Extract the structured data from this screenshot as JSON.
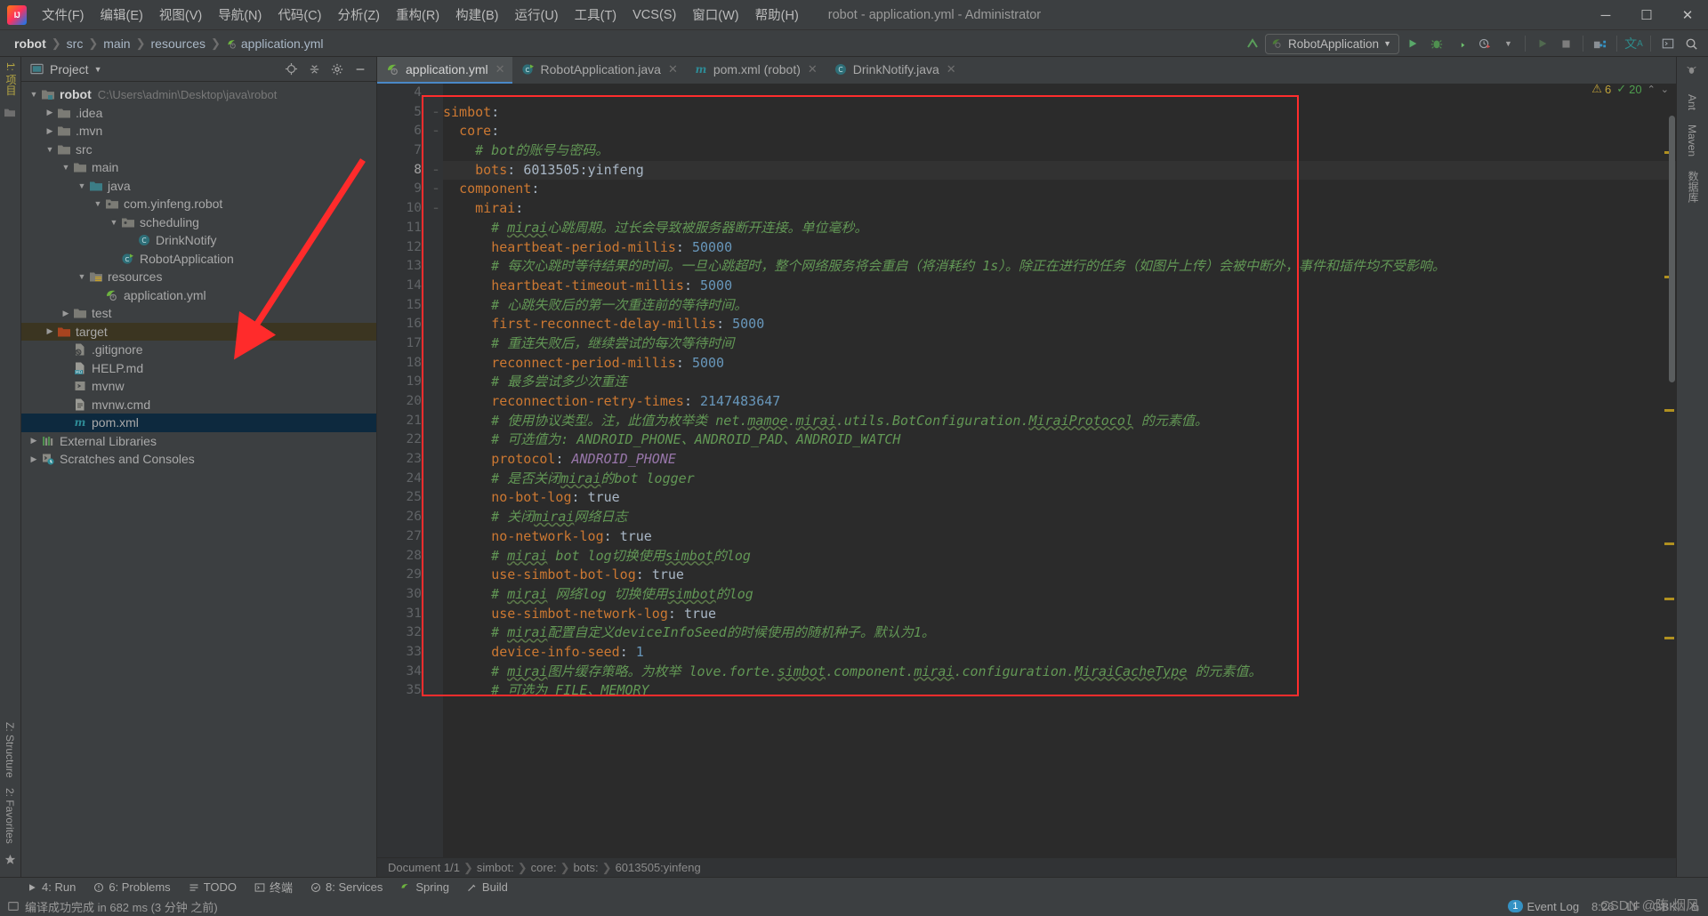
{
  "window": {
    "title": "robot - application.yml - Administrator",
    "controls": [
      "minimize",
      "maximize",
      "close"
    ]
  },
  "menubar": {
    "items": [
      "文件(F)",
      "编辑(E)",
      "视图(V)",
      "导航(N)",
      "代码(C)",
      "分析(Z)",
      "重构(R)",
      "构建(B)",
      "运行(U)",
      "工具(T)",
      "VCS(S)",
      "窗口(W)",
      "帮助(H)"
    ]
  },
  "breadcrumb": {
    "items": [
      "robot",
      "src",
      "main",
      "resources",
      "application.yml"
    ]
  },
  "run_config": {
    "name": "RobotApplication",
    "dropdown_glyph": "▼"
  },
  "toolbar_right": {
    "buttons": [
      "update-project-icon",
      "run-icon",
      "debug-icon",
      "run-coverage-icon",
      "profiler-icon",
      "profiler-dropdown-icon",
      "run-step-icon",
      "stop-icon",
      "build-project-icon",
      "translate-icon",
      "terminal-icon",
      "search-everywhere-icon"
    ]
  },
  "left_strip": {
    "top_tab": "1: 项目",
    "bottom_tabs": [
      "Z: Structure",
      "2: Favorites"
    ]
  },
  "right_strip": {
    "tabs": [
      "Maven",
      "数据库",
      "Ant"
    ]
  },
  "project_panel": {
    "title": "Project",
    "title_chevron": "▼",
    "header_buttons": [
      "locate-icon",
      "collapse-all-icon",
      "settings-icon",
      "hide-icon"
    ],
    "tree": [
      {
        "depth": 0,
        "twisty": "open",
        "icon": "module-folder",
        "label": "robot",
        "bold": true,
        "path": "C:\\Users\\admin\\Desktop\\java\\robot",
        "selected": "none"
      },
      {
        "depth": 1,
        "twisty": "closed",
        "icon": "folder",
        "label": ".idea",
        "selected": "none"
      },
      {
        "depth": 1,
        "twisty": "closed",
        "icon": "folder",
        "label": ".mvn",
        "selected": "none"
      },
      {
        "depth": 1,
        "twisty": "open",
        "icon": "folder",
        "label": "src",
        "selected": "none"
      },
      {
        "depth": 2,
        "twisty": "open",
        "icon": "folder",
        "label": "main",
        "selected": "none"
      },
      {
        "depth": 3,
        "twisty": "open",
        "icon": "source-folder",
        "label": "java",
        "selected": "none"
      },
      {
        "depth": 4,
        "twisty": "open",
        "icon": "package",
        "label": "com.yinfeng.robot",
        "selected": "none"
      },
      {
        "depth": 5,
        "twisty": "open",
        "icon": "package",
        "label": "scheduling",
        "selected": "none"
      },
      {
        "depth": 6,
        "twisty": "none",
        "icon": "java-class",
        "label": "DrinkNotify",
        "selected": "none"
      },
      {
        "depth": 5,
        "twisty": "none",
        "icon": "spring-class",
        "label": "RobotApplication",
        "selected": "none"
      },
      {
        "depth": 3,
        "twisty": "open",
        "icon": "resource-folder",
        "label": "resources",
        "selected": "none"
      },
      {
        "depth": 4,
        "twisty": "none",
        "icon": "spring-yaml",
        "label": "application.yml",
        "selected": "none"
      },
      {
        "depth": 2,
        "twisty": "closed",
        "icon": "folder",
        "label": "test",
        "selected": "none"
      },
      {
        "depth": 1,
        "twisty": "closed",
        "icon": "excluded-folder",
        "label": "target",
        "selected": "orange"
      },
      {
        "depth": 2,
        "twisty": "none",
        "icon": "gitignore",
        "label": ".gitignore",
        "selected": "none"
      },
      {
        "depth": 2,
        "twisty": "none",
        "icon": "markdown",
        "label": "HELP.md",
        "selected": "none"
      },
      {
        "depth": 2,
        "twisty": "none",
        "icon": "shell-script",
        "label": "mvnw",
        "selected": "none"
      },
      {
        "depth": 2,
        "twisty": "none",
        "icon": "cmd-file",
        "label": "mvnw.cmd",
        "selected": "none"
      },
      {
        "depth": 2,
        "twisty": "none",
        "icon": "maven-pom",
        "label": "pom.xml",
        "selected": "blur"
      },
      {
        "depth": 0,
        "twisty": "closed",
        "icon": "libraries",
        "label": "External Libraries",
        "selected": "none"
      },
      {
        "depth": 0,
        "twisty": "closed",
        "icon": "scratches",
        "label": "Scratches and Consoles",
        "selected": "none"
      }
    ]
  },
  "editor_tabs": [
    {
      "label": "application.yml",
      "icon": "spring-yaml",
      "active": true
    },
    {
      "label": "RobotApplication.java",
      "icon": "spring-class",
      "active": false
    },
    {
      "label": "pom.xml (robot)",
      "icon": "maven-pom",
      "active": false
    },
    {
      "label": "DrinkNotify.java",
      "icon": "java-class",
      "active": false
    }
  ],
  "editor_status_right": {
    "warnings": "6",
    "checks": "20",
    "warn_glyph": "⚠",
    "ok_glyph": "✓",
    "up_glyph": "⌃",
    "down_glyph": "⌄"
  },
  "code": {
    "first_line": 4,
    "current_line": 8,
    "lines": [
      {
        "n": 4,
        "fold": "",
        "tokens": []
      },
      {
        "n": 5,
        "fold": "−",
        "tokens": [
          {
            "t": "simbot",
            "c": "k"
          },
          {
            "t": ":",
            "c": "p"
          }
        ]
      },
      {
        "n": 6,
        "fold": "−",
        "tokens": [
          {
            "t": "  ",
            "c": "p"
          },
          {
            "t": "core",
            "c": "k"
          },
          {
            "t": ":",
            "c": "p"
          }
        ]
      },
      {
        "n": 7,
        "fold": "",
        "tokens": [
          {
            "t": "    # bot的账号与密码。",
            "c": "c"
          }
        ]
      },
      {
        "n": 8,
        "fold": "−",
        "tokens": [
          {
            "t": "    ",
            "c": "p"
          },
          {
            "t": "bots",
            "c": "k"
          },
          {
            "t": ": ",
            "c": "p"
          },
          {
            "t": "6013505:yinfeng",
            "c": "s"
          }
        ],
        "highlight": true
      },
      {
        "n": 9,
        "fold": "−",
        "tokens": [
          {
            "t": "  ",
            "c": "p"
          },
          {
            "t": "component",
            "c": "k"
          },
          {
            "t": ":",
            "c": "p"
          }
        ]
      },
      {
        "n": 10,
        "fold": "−",
        "tokens": [
          {
            "t": "    ",
            "c": "p"
          },
          {
            "t": "mirai",
            "c": "k"
          },
          {
            "t": ":",
            "c": "p"
          }
        ]
      },
      {
        "n": 11,
        "fold": "",
        "tokens": [
          {
            "t": "      # ",
            "c": "c"
          },
          {
            "t": "mirai",
            "c": "c sq"
          },
          {
            "t": "心跳周期。过长会导致被服务器断开连接。单位毫秒。",
            "c": "c"
          }
        ]
      },
      {
        "n": 12,
        "fold": "",
        "tokens": [
          {
            "t": "      ",
            "c": "p"
          },
          {
            "t": "heartbeat-period-millis",
            "c": "k"
          },
          {
            "t": ": ",
            "c": "p"
          },
          {
            "t": "50000",
            "c": "n"
          }
        ]
      },
      {
        "n": 13,
        "fold": "",
        "tokens": [
          {
            "t": "      # 每次心跳时等待结果的时间。一旦心跳超时，整个网络服务将会重启（将消耗约 1s）。除正在进行的任务（如图片上传）会被中断外，事件和插件均不受影响。",
            "c": "c"
          }
        ]
      },
      {
        "n": 14,
        "fold": "",
        "tokens": [
          {
            "t": "      ",
            "c": "p"
          },
          {
            "t": "heartbeat-timeout-millis",
            "c": "k"
          },
          {
            "t": ": ",
            "c": "p"
          },
          {
            "t": "5000",
            "c": "n"
          }
        ]
      },
      {
        "n": 15,
        "fold": "",
        "tokens": [
          {
            "t": "      # 心跳失败后的第一次重连前的等待时间。",
            "c": "c"
          }
        ]
      },
      {
        "n": 16,
        "fold": "",
        "tokens": [
          {
            "t": "      ",
            "c": "p"
          },
          {
            "t": "first-reconnect-delay-millis",
            "c": "k"
          },
          {
            "t": ": ",
            "c": "p"
          },
          {
            "t": "5000",
            "c": "n"
          }
        ]
      },
      {
        "n": 17,
        "fold": "",
        "tokens": [
          {
            "t": "      # 重连失败后，继续尝试的每次等待时间",
            "c": "c"
          }
        ]
      },
      {
        "n": 18,
        "fold": "",
        "tokens": [
          {
            "t": "      ",
            "c": "p"
          },
          {
            "t": "reconnect-period-millis",
            "c": "k"
          },
          {
            "t": ": ",
            "c": "p"
          },
          {
            "t": "5000",
            "c": "n"
          }
        ]
      },
      {
        "n": 19,
        "fold": "",
        "tokens": [
          {
            "t": "      # 最多尝试多少次重连",
            "c": "c"
          }
        ]
      },
      {
        "n": 20,
        "fold": "",
        "tokens": [
          {
            "t": "      ",
            "c": "p"
          },
          {
            "t": "reconnection-retry-times",
            "c": "k"
          },
          {
            "t": ": ",
            "c": "p"
          },
          {
            "t": "2147483647",
            "c": "n"
          }
        ]
      },
      {
        "n": 21,
        "fold": "",
        "tokens": [
          {
            "t": "      # 使用协议类型。注，此值为枚举类 net.",
            "c": "c"
          },
          {
            "t": "mamoe",
            "c": "c sq"
          },
          {
            "t": ".",
            "c": "c"
          },
          {
            "t": "mirai",
            "c": "c sq"
          },
          {
            "t": ".utils.BotConfiguration.",
            "c": "c"
          },
          {
            "t": "MiraiProtocol",
            "c": "c sq"
          },
          {
            "t": " 的元素值。",
            "c": "c"
          }
        ]
      },
      {
        "n": 22,
        "fold": "",
        "tokens": [
          {
            "t": "      # 可选值为: ANDROID_PHONE、ANDROID_PAD、ANDROID_WATCH",
            "c": "c"
          }
        ]
      },
      {
        "n": 23,
        "fold": "",
        "tokens": [
          {
            "t": "      ",
            "c": "p"
          },
          {
            "t": "protocol",
            "c": "k"
          },
          {
            "t": ": ",
            "c": "p"
          },
          {
            "t": "ANDROID_PHONE",
            "c": "e"
          }
        ]
      },
      {
        "n": 24,
        "fold": "",
        "tokens": [
          {
            "t": "      # 是否关闭",
            "c": "c"
          },
          {
            "t": "mirai",
            "c": "c sq"
          },
          {
            "t": "的bot logger",
            "c": "c"
          }
        ]
      },
      {
        "n": 25,
        "fold": "",
        "tokens": [
          {
            "t": "      ",
            "c": "p"
          },
          {
            "t": "no-bot-log",
            "c": "k"
          },
          {
            "t": ": ",
            "c": "p"
          },
          {
            "t": "true",
            "c": "s"
          }
        ]
      },
      {
        "n": 26,
        "fold": "",
        "tokens": [
          {
            "t": "      # 关闭",
            "c": "c"
          },
          {
            "t": "mirai",
            "c": "c sq"
          },
          {
            "t": "网络日志",
            "c": "c"
          }
        ]
      },
      {
        "n": 27,
        "fold": "",
        "tokens": [
          {
            "t": "      ",
            "c": "p"
          },
          {
            "t": "no-network-log",
            "c": "k"
          },
          {
            "t": ": ",
            "c": "p"
          },
          {
            "t": "true",
            "c": "s"
          }
        ]
      },
      {
        "n": 28,
        "fold": "",
        "tokens": [
          {
            "t": "      # ",
            "c": "c"
          },
          {
            "t": "mirai",
            "c": "c sq"
          },
          {
            "t": " bot log切换使用",
            "c": "c"
          },
          {
            "t": "simbot",
            "c": "c sq"
          },
          {
            "t": "的log",
            "c": "c"
          }
        ]
      },
      {
        "n": 29,
        "fold": "",
        "tokens": [
          {
            "t": "      ",
            "c": "p"
          },
          {
            "t": "use-simbot-bot-log",
            "c": "k"
          },
          {
            "t": ": ",
            "c": "p"
          },
          {
            "t": "true",
            "c": "s"
          }
        ]
      },
      {
        "n": 30,
        "fold": "",
        "tokens": [
          {
            "t": "      # ",
            "c": "c"
          },
          {
            "t": "mirai",
            "c": "c sq"
          },
          {
            "t": " 网络log 切换使用",
            "c": "c"
          },
          {
            "t": "simbot",
            "c": "c sq"
          },
          {
            "t": "的log",
            "c": "c"
          }
        ]
      },
      {
        "n": 31,
        "fold": "",
        "tokens": [
          {
            "t": "      ",
            "c": "p"
          },
          {
            "t": "use-simbot-network-log",
            "c": "k"
          },
          {
            "t": ": ",
            "c": "p"
          },
          {
            "t": "true",
            "c": "s"
          }
        ]
      },
      {
        "n": 32,
        "fold": "",
        "tokens": [
          {
            "t": "      # ",
            "c": "c"
          },
          {
            "t": "mirai",
            "c": "c sq"
          },
          {
            "t": "配置自定义deviceInfoSeed的时候使用的随机种子。默认为1。",
            "c": "c"
          }
        ]
      },
      {
        "n": 33,
        "fold": "",
        "tokens": [
          {
            "t": "      ",
            "c": "p"
          },
          {
            "t": "device-info-seed",
            "c": "k"
          },
          {
            "t": ": ",
            "c": "p"
          },
          {
            "t": "1",
            "c": "n"
          }
        ]
      },
      {
        "n": 34,
        "fold": "",
        "tokens": [
          {
            "t": "      # ",
            "c": "c"
          },
          {
            "t": "mirai",
            "c": "c sq"
          },
          {
            "t": "图片缓存策略。为枚举 love.forte.",
            "c": "c"
          },
          {
            "t": "simbot",
            "c": "c sq"
          },
          {
            "t": ".component.",
            "c": "c"
          },
          {
            "t": "mirai",
            "c": "c sq"
          },
          {
            "t": ".configuration.",
            "c": "c"
          },
          {
            "t": "MiraiCacheType",
            "c": "c sq"
          },
          {
            "t": " 的元素值。",
            "c": "c"
          }
        ]
      },
      {
        "n": 35,
        "fold": "",
        "tokens": [
          {
            "t": "      # 可选为 FILE、MEMORY",
            "c": "c"
          }
        ]
      }
    ]
  },
  "document_status": {
    "doc_label": "Document 1/1",
    "crumbs": [
      "simbot:",
      "core:",
      "bots:",
      "6013505:yinfeng"
    ]
  },
  "bottom_toolbar": {
    "items": [
      {
        "icon": "run-icon",
        "label": "4: Run"
      },
      {
        "icon": "problems-icon",
        "label": "6: Problems"
      },
      {
        "icon": "todo-icon",
        "label": "TODO"
      },
      {
        "icon": "terminal-icon",
        "label": "终端"
      },
      {
        "icon": "services-icon",
        "label": "8: Services"
      },
      {
        "icon": "spring-icon",
        "label": "Spring"
      },
      {
        "icon": "build-icon",
        "label": "Build"
      }
    ]
  },
  "statusbar": {
    "message": "编译成功完成 in 682 ms (3 分钟 之前)",
    "event_log": {
      "count": "1",
      "label": "Event Log"
    },
    "caret": "8:26",
    "line_sep": "LF",
    "encoding": "GBK",
    "lock_icon": "lock-icon"
  },
  "watermark": "CSDN @陈 烟风",
  "colors": {
    "panel_bg": "#3c3f41",
    "editor_bg": "#2b2b2b",
    "gutter_bg": "#313335",
    "key": "#cc7832",
    "comment": "#629755",
    "number": "#6897bb",
    "enum": "#9876aa",
    "text": "#a9b7c6",
    "accent_tab": "#4a88c7",
    "annotation_red": "#ff2d2d",
    "selection_blue": "#0d293e",
    "selection_orange": "#3b3521"
  }
}
